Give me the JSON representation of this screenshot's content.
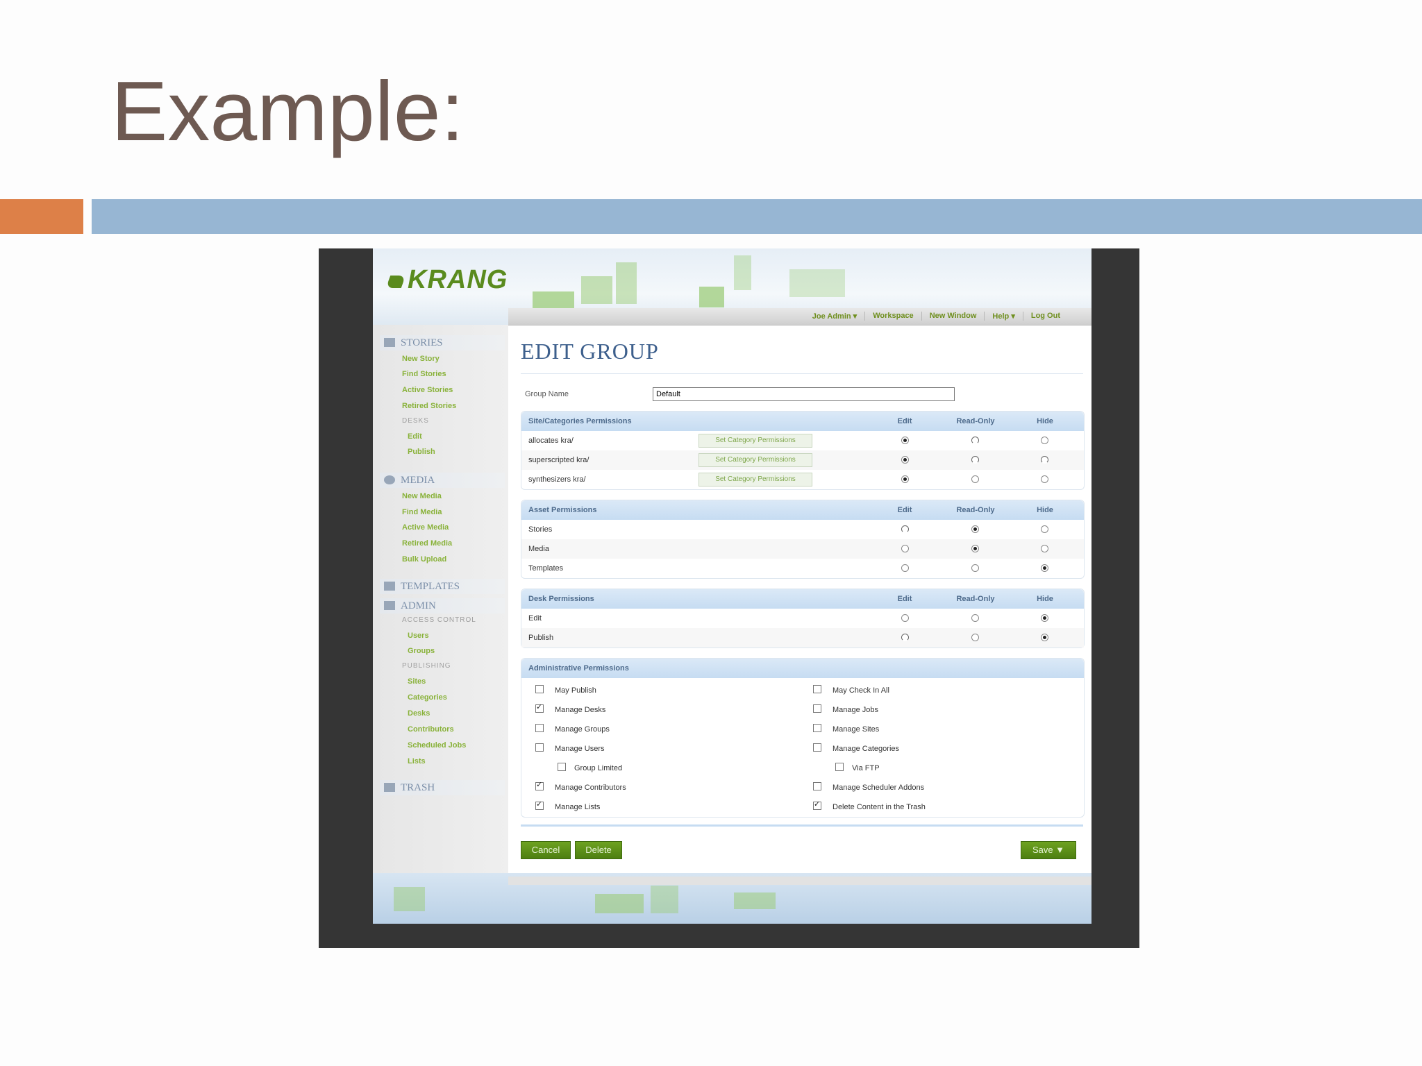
{
  "slide": {
    "title": "Example:"
  },
  "app": {
    "logo": "KRANG",
    "topnav": [
      "Joe Admin ▾",
      "Workspace",
      "New Window",
      "Help ▾",
      "Log Out"
    ],
    "sidebar": {
      "stories": {
        "title": "STORIES",
        "links": [
          "New Story",
          "Find Stories",
          "Active Stories",
          "Retired Stories"
        ],
        "desks_caption": "DESKS",
        "desk_links": [
          "Edit",
          "Publish"
        ]
      },
      "media": {
        "title": "MEDIA",
        "links": [
          "New Media",
          "Find Media",
          "Active Media",
          "Retired Media",
          "Bulk Upload"
        ]
      },
      "templates": {
        "title": "TEMPLATES"
      },
      "admin": {
        "title": "ADMIN",
        "access_caption": "ACCESS CONTROL",
        "access_links": [
          "Users",
          "Groups"
        ],
        "publishing_caption": "PUBLISHING",
        "publishing_links": [
          "Sites",
          "Categories",
          "Desks",
          "Contributors",
          "Scheduled Jobs",
          "Lists"
        ]
      },
      "trash": {
        "title": "TRASH"
      }
    },
    "page_title": "EDIT GROUP",
    "group_name_label": "Group Name",
    "group_name_value": "Default",
    "columns": {
      "edit": "Edit",
      "read_only": "Read-Only",
      "hide": "Hide"
    },
    "site_permissions": {
      "title": "Site/Categories Permissions",
      "button_label": "Set Category Permissions",
      "rows": [
        {
          "name": "allocates kra/",
          "selected": "edit"
        },
        {
          "name": "superscripted kra/",
          "selected": "edit"
        },
        {
          "name": "synthesizers kra/",
          "selected": "edit"
        }
      ]
    },
    "asset_permissions": {
      "title": "Asset Permissions",
      "rows": [
        {
          "name": "Stories",
          "selected": "read_only"
        },
        {
          "name": "Media",
          "selected": "read_only"
        },
        {
          "name": "Templates",
          "selected": "hide"
        }
      ]
    },
    "desk_permissions": {
      "title": "Desk Permissions",
      "rows": [
        {
          "name": "Edit",
          "selected": "hide"
        },
        {
          "name": "Publish",
          "selected": "hide"
        }
      ]
    },
    "admin_permissions": {
      "title": "Administrative Permissions",
      "left": [
        {
          "label": "May Publish",
          "checked": false
        },
        {
          "label": "Manage Desks",
          "checked": true
        },
        {
          "label": "Manage Groups",
          "checked": false
        },
        {
          "label": "Manage Users",
          "checked": false
        },
        {
          "label": "Group Limited",
          "checked": false
        },
        {
          "label": "Manage Contributors",
          "checked": true
        },
        {
          "label": "Manage Lists",
          "checked": true
        }
      ],
      "right": [
        {
          "label": "May Check In All",
          "checked": false
        },
        {
          "label": "Manage Jobs",
          "checked": false
        },
        {
          "label": "Manage Sites",
          "checked": false
        },
        {
          "label": "Manage Categories",
          "checked": false
        },
        {
          "label": "Via FTP",
          "checked": false
        },
        {
          "label": "Manage Scheduler Addons",
          "checked": false
        },
        {
          "label": "Delete Content in the Trash",
          "checked": true
        }
      ]
    },
    "buttons": {
      "cancel": "Cancel",
      "delete": "Delete",
      "save": "Save ▼"
    },
    "colors": {
      "brand_green": "#5a8b1e",
      "header_blue": "#c6dcf2",
      "slide_orange": "#dd8048",
      "slide_blue": "#97b6d3"
    }
  }
}
